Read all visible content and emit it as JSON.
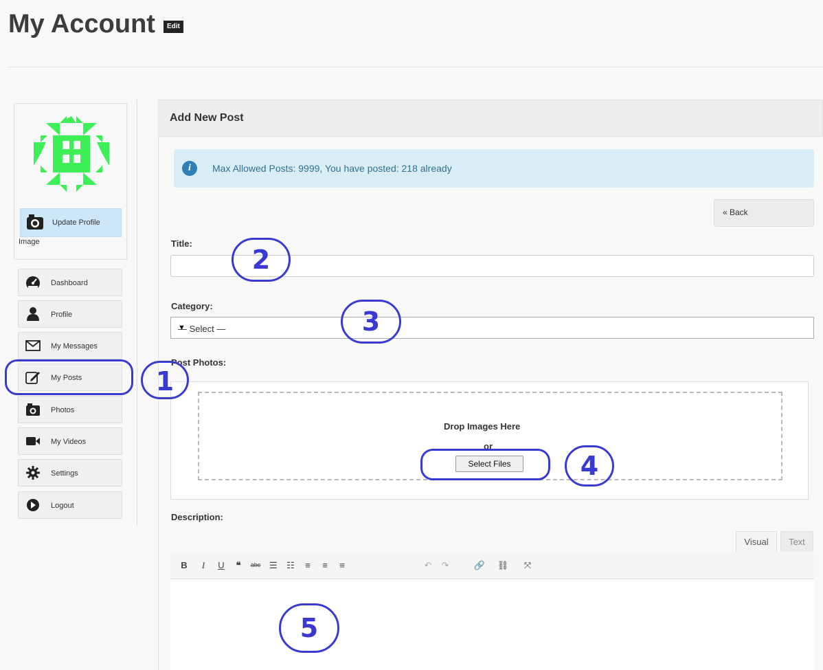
{
  "page": {
    "title": "My Account",
    "edit_badge": "Edit"
  },
  "sidebar": {
    "update_profile_label": "Update Profile",
    "update_profile_label_2": "Image",
    "items": [
      {
        "label": "Dashboard",
        "icon": "dashboard-icon"
      },
      {
        "label": "Profile",
        "icon": "user-icon"
      },
      {
        "label": "My Messages",
        "icon": "envelope-icon"
      },
      {
        "label": "My Posts",
        "icon": "edit-icon"
      },
      {
        "label": "Photos",
        "icon": "camera-icon"
      },
      {
        "label": "My Videos",
        "icon": "video-camera-icon"
      },
      {
        "label": "Settings",
        "icon": "gear-icon"
      },
      {
        "label": "Logout",
        "icon": "logout-icon"
      }
    ]
  },
  "panel": {
    "title": "Add New Post",
    "info_text": "Max Allowed Posts: 9999, You have posted: 218 already",
    "back_label": "« Back",
    "title_label": "Title:",
    "title_value": "",
    "category_label": "Category:",
    "category_selected": "— Select —",
    "photos_label": "Post Photos:",
    "drop_text": "Drop Images Here",
    "or_text": "or",
    "select_files_label": "Select Files",
    "description_label": "Description:",
    "tab_visual": "Visual",
    "tab_text": "Text",
    "toolbar": [
      "B",
      "I",
      "U",
      "66",
      "abc",
      "list",
      "olist",
      "alignleft",
      "aligncenter",
      "alignright",
      "undo",
      "redo",
      "link",
      "unlink",
      "fullscreen"
    ]
  },
  "annotations": [
    "1",
    "2",
    "3",
    "4",
    "5"
  ],
  "colors": {
    "accent_blue": "#3a3ad0",
    "info_bg": "#d9edf7",
    "avatar_green": "#3df058"
  }
}
